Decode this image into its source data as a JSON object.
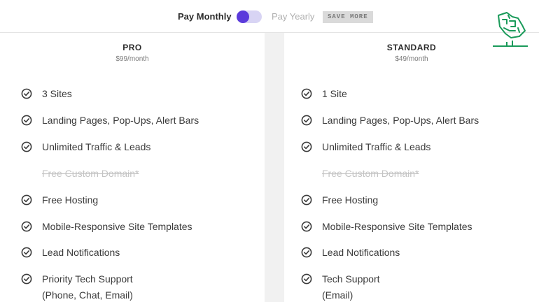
{
  "toggle": {
    "monthly_label": "Pay Monthly",
    "yearly_label": "Pay Yearly",
    "save_badge": "SAVE MORE",
    "selected": "monthly",
    "accent_color": "#5b3bdb"
  },
  "plans": [
    {
      "name": "PRO",
      "price": "$99/month",
      "features": [
        {
          "text": "3 Sites",
          "included": true
        },
        {
          "text": "Landing Pages, Pop-Ups, Alert Bars",
          "included": true
        },
        {
          "text": "Unlimited Traffic & Leads",
          "included": true
        },
        {
          "text": "Free Custom Domain*",
          "included": false
        },
        {
          "text": "Free Hosting",
          "included": true
        },
        {
          "text": "Mobile-Responsive Site Templates",
          "included": true
        },
        {
          "text": "Lead Notifications",
          "included": true
        },
        {
          "text": "Priority Tech Support",
          "line2": "(Phone, Chat, Email)",
          "included": true
        }
      ]
    },
    {
      "name": "STANDARD",
      "price": "$49/month",
      "features": [
        {
          "text": "1 Site",
          "included": true
        },
        {
          "text": "Landing Pages, Pop-Ups, Alert Bars",
          "included": true
        },
        {
          "text": "Unlimited Traffic & Leads",
          "included": true
        },
        {
          "text": "Free Custom Domain*",
          "included": false
        },
        {
          "text": "Free Hosting",
          "included": true
        },
        {
          "text": "Mobile-Responsive Site Templates",
          "included": true
        },
        {
          "text": "Lead Notifications",
          "included": true
        },
        {
          "text": "Tech Support",
          "line2": "(Email)",
          "included": true
        }
      ]
    }
  ],
  "logo": {
    "icon": "saudi-map-logo-icon",
    "color": "#1a9a5a"
  }
}
